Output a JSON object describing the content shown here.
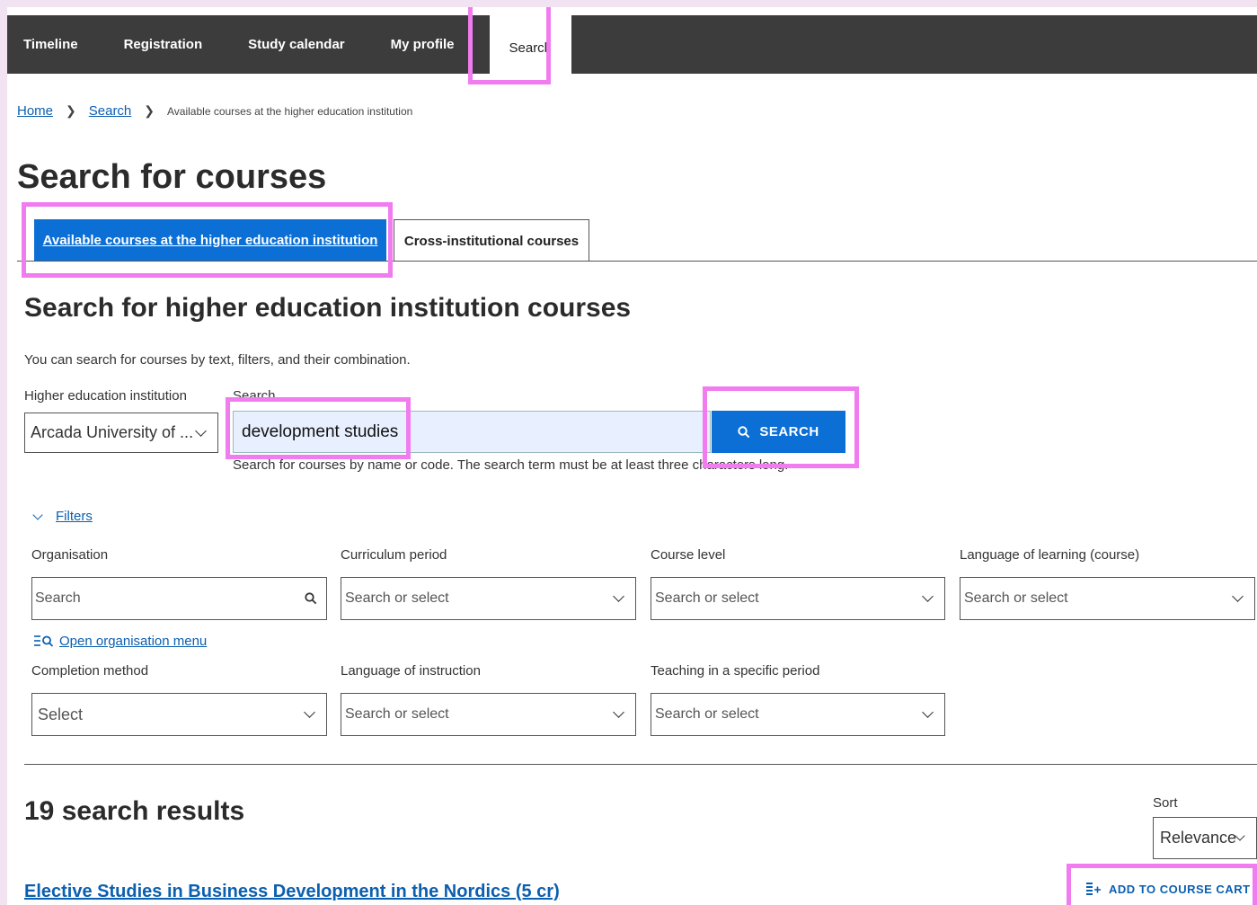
{
  "nav": {
    "items": [
      "Timeline",
      "Registration",
      "Study calendar",
      "My profile"
    ],
    "active": "Search"
  },
  "breadcrumb": {
    "home": "Home",
    "search": "Search",
    "current": "Available courses at the higher education institution"
  },
  "page_title": "Search for courses",
  "tabs": {
    "active": "Available courses at the higher education institution",
    "other": "Cross-institutional courses"
  },
  "section": {
    "title": "Search for higher education institution courses",
    "description": "You can search for courses by text, filters, and their combination."
  },
  "institution": {
    "label": "Higher education institution",
    "value": "Arcada University of ..."
  },
  "search": {
    "label": "Search",
    "value": "development studies",
    "button": "SEARCH",
    "help": "Search for courses by name or code. The search term must be at least three characters long."
  },
  "filters": {
    "toggle": "Filters",
    "organisation": {
      "label": "Organisation",
      "placeholder": "Search"
    },
    "org_menu": "Open organisation menu",
    "curriculum_period": {
      "label": "Curriculum period",
      "placeholder": "Search or select"
    },
    "course_level": {
      "label": "Course level",
      "placeholder": "Search or select"
    },
    "language_learning": {
      "label": "Language of learning (course)",
      "placeholder": "Search or select"
    },
    "completion_method": {
      "label": "Completion method",
      "placeholder": "Select"
    },
    "language_instruction": {
      "label": "Language of instruction",
      "placeholder": "Search or select"
    },
    "teaching_period": {
      "label": "Teaching in a specific period",
      "placeholder": "Search or select"
    }
  },
  "results": {
    "title": "19 search results",
    "sort_label": "Sort",
    "sort_value": "Relevance",
    "first_course": "Elective Studies in Business Development in the Nordics (5 cr)",
    "add_to_cart": "ADD TO COURSE CART"
  },
  "colors": {
    "accent": "#0b6fd6",
    "highlight": "#f07cf0",
    "nav_bg": "#3c3c3c"
  }
}
